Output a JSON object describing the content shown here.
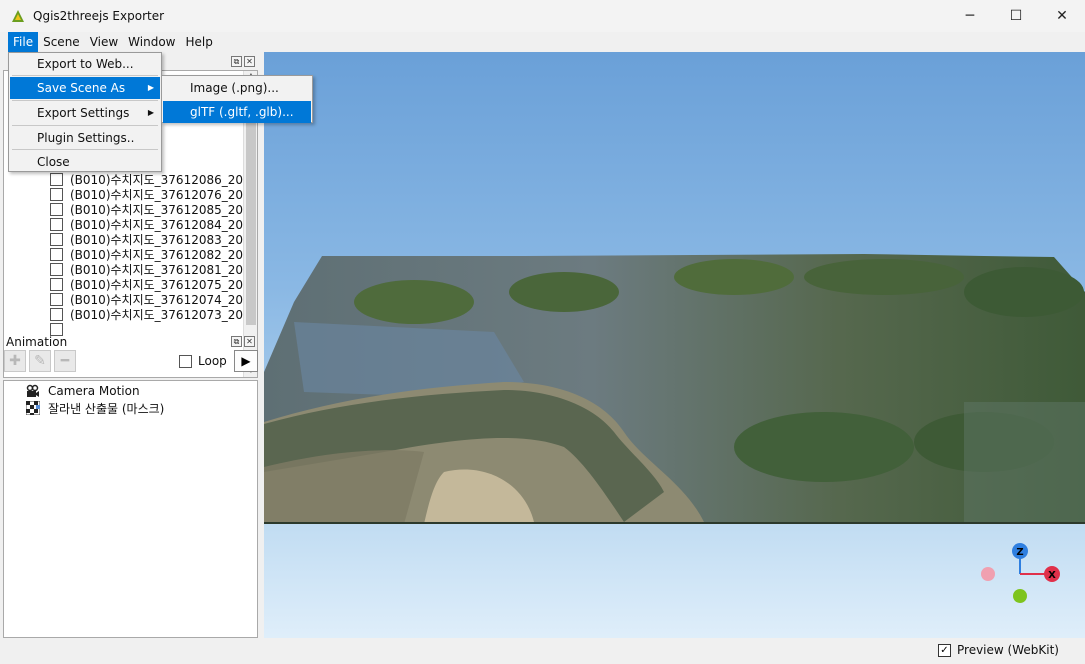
{
  "window": {
    "title": "Qgis2threejs Exporter",
    "controls": {
      "minimize": "─",
      "maximize": "☐",
      "close": "✕"
    }
  },
  "menubar": {
    "items": [
      {
        "label": "File",
        "key": "file"
      },
      {
        "label": "Scene",
        "key": "scene"
      },
      {
        "label": "View",
        "key": "view"
      },
      {
        "label": "Window",
        "key": "window"
      },
      {
        "label": "Help",
        "key": "help"
      }
    ]
  },
  "file_menu": {
    "items": [
      {
        "label": "Export to Web..."
      },
      {
        "label": "Save Scene As",
        "has_submenu": true
      },
      {
        "label": "Export Settings",
        "has_submenu": true
      },
      {
        "label": "Plugin Settings.."
      },
      {
        "label": "Close"
      }
    ]
  },
  "save_scene_submenu": {
    "items": [
      {
        "label": "Image (.png)..."
      },
      {
        "label": "glTF (.gltf, .glb)..."
      }
    ]
  },
  "layers_panel": {
    "layers": [
      {
        "label": "(B010)수치지도_37612086_20..."
      },
      {
        "label": "(B010)수치지도_37612076_20..."
      },
      {
        "label": "(B010)수치지도_37612085_20..."
      },
      {
        "label": "(B010)수치지도_37612084_20..."
      },
      {
        "label": "(B010)수치지도_37612083_20..."
      },
      {
        "label": "(B010)수치지도_37612082_20..."
      },
      {
        "label": "(B010)수치지도_37612081_20..."
      },
      {
        "label": "(B010)수치지도_37612075_20..."
      },
      {
        "label": "(B010)수치지도_37612074_20..."
      },
      {
        "label": "(B010)수치지도_37612073_20..."
      }
    ]
  },
  "animation_panel": {
    "title": "Animation",
    "loop_label": "Loop",
    "play_icon": "▶",
    "items": [
      {
        "label": "Camera Motion",
        "icon": "camera-icon"
      },
      {
        "label": "잘라낸 산출물 (마스크)",
        "icon": "mask-icon"
      }
    ]
  },
  "gizmo": {
    "z_label": "Z",
    "x_label": "X",
    "colors": {
      "z": "#2f7fe0",
      "x": "#e0304a",
      "y": "#7ec41e",
      "neg_x": "#f0a0b0"
    }
  },
  "statusbar": {
    "preview_label": "Preview (WebKit)",
    "preview_checked": "✓"
  }
}
